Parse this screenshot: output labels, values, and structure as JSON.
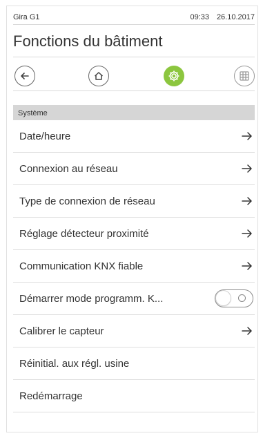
{
  "status": {
    "device": "Gira G1",
    "time": "09:33",
    "date": "26.10.2017"
  },
  "page_title": "Fonctions du bâtiment",
  "nav": {
    "back_icon": "back-arrow-icon",
    "home_icon": "home-icon",
    "settings_icon": "gear-icon",
    "grid_icon": "grid-icon",
    "active": "settings",
    "accent_color": "#8cc63f"
  },
  "section": {
    "label": "Système"
  },
  "items": [
    {
      "label": "Date/heure",
      "control": "arrow"
    },
    {
      "label": "Connexion au réseau",
      "control": "arrow"
    },
    {
      "label": "Type de connexion de réseau",
      "control": "arrow"
    },
    {
      "label": "Réglage détecteur proximité",
      "control": "arrow"
    },
    {
      "label": "Communication KNX fiable",
      "control": "arrow"
    },
    {
      "label": "Démarrer mode programm. K...",
      "control": "toggle",
      "toggle_on": false
    },
    {
      "label": "Calibrer le capteur",
      "control": "arrow"
    },
    {
      "label": "Réinitial. aux régl. usine",
      "control": "none"
    },
    {
      "label": "Redémarrage",
      "control": "none"
    }
  ]
}
